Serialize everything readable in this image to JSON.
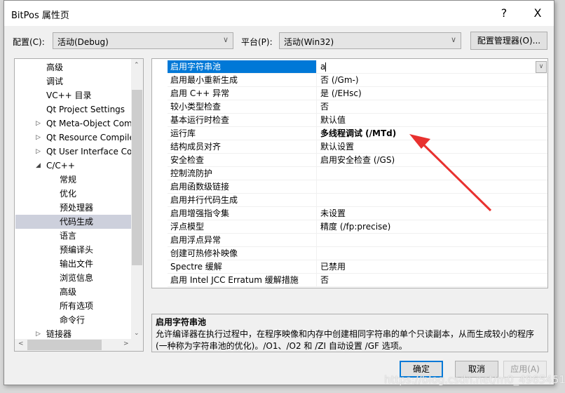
{
  "window": {
    "title": "BitPos 属性页",
    "help_label": "?",
    "close_label": "X"
  },
  "toolbar": {
    "config_label": "配置(C):",
    "config_value": "活动(Debug)",
    "platform_label": "平台(P):",
    "platform_value": "活动(Win32)",
    "config_manager_label": "配置管理器(O)..."
  },
  "tree": {
    "items": [
      {
        "label": "高级",
        "level": 1
      },
      {
        "label": "调试",
        "level": 1
      },
      {
        "label": "VC++ 目录",
        "level": 1
      },
      {
        "label": "Qt Project Settings",
        "level": 1
      },
      {
        "label": "Qt Meta-Object Com",
        "level": 1,
        "expander": "▷"
      },
      {
        "label": "Qt Resource Compile",
        "level": 1,
        "expander": "▷"
      },
      {
        "label": "Qt User Interface Cor",
        "level": 1,
        "expander": "▷"
      },
      {
        "label": "C/C++",
        "level": 1,
        "expander": "◢"
      },
      {
        "label": "常规",
        "level": 2
      },
      {
        "label": "优化",
        "level": 2
      },
      {
        "label": "预处理器",
        "level": 2
      },
      {
        "label": "代码生成",
        "level": 2,
        "selected": true
      },
      {
        "label": "语言",
        "level": 2
      },
      {
        "label": "预编译头",
        "level": 2
      },
      {
        "label": "输出文件",
        "level": 2
      },
      {
        "label": "浏览信息",
        "level": 2
      },
      {
        "label": "高级",
        "level": 2
      },
      {
        "label": "所有选项",
        "level": 2
      },
      {
        "label": "命令行",
        "level": 2
      },
      {
        "label": "链接器",
        "level": 1,
        "expander": "▷"
      }
    ]
  },
  "properties": [
    {
      "name": "启用字符串池",
      "value": "a",
      "selected": true
    },
    {
      "name": "启用最小重新生成",
      "value": "否 (/Gm-)"
    },
    {
      "name": "启用 C++ 异常",
      "value": "是 (/EHsc)"
    },
    {
      "name": "较小类型检查",
      "value": "否"
    },
    {
      "name": "基本运行时检查",
      "value": "默认值"
    },
    {
      "name": "运行库",
      "value": "多线程调试 (/MTd)",
      "bold": true
    },
    {
      "name": "结构成员对齐",
      "value": "默认设置"
    },
    {
      "name": "安全检查",
      "value": "启用安全检查 (/GS)"
    },
    {
      "name": "控制流防护",
      "value": ""
    },
    {
      "name": "启用函数级链接",
      "value": ""
    },
    {
      "name": "启用并行代码生成",
      "value": ""
    },
    {
      "name": "启用增强指令集",
      "value": "未设置"
    },
    {
      "name": "浮点模型",
      "value": "精度 (/fp:precise)"
    },
    {
      "name": "启用浮点异常",
      "value": ""
    },
    {
      "name": "创建可热修补映像",
      "value": ""
    },
    {
      "name": "Spectre 缓解",
      "value": "已禁用"
    },
    {
      "name": "启用 Intel JCC Erratum 缓解措施",
      "value": "否"
    }
  ],
  "description": {
    "title": "启用字符串池",
    "text": "允许编译器在执行过程中，在程序映像和内存中创建相同字符串的单个只读副本，从而生成较小的程序(一种称为字符串池的优化)。/O1、/O2 和 /ZI 自动设置 /GF 选项。"
  },
  "buttons": {
    "ok": "确定",
    "cancel": "取消",
    "apply": "应用(A)"
  },
  "annotation": {
    "arrow_color": "#e8312f"
  },
  "watermark": "https://blog.csdn.net/m0_49654518",
  "colors": {
    "selection": "#0078d7",
    "tree_selection": "#cdd0dc"
  }
}
